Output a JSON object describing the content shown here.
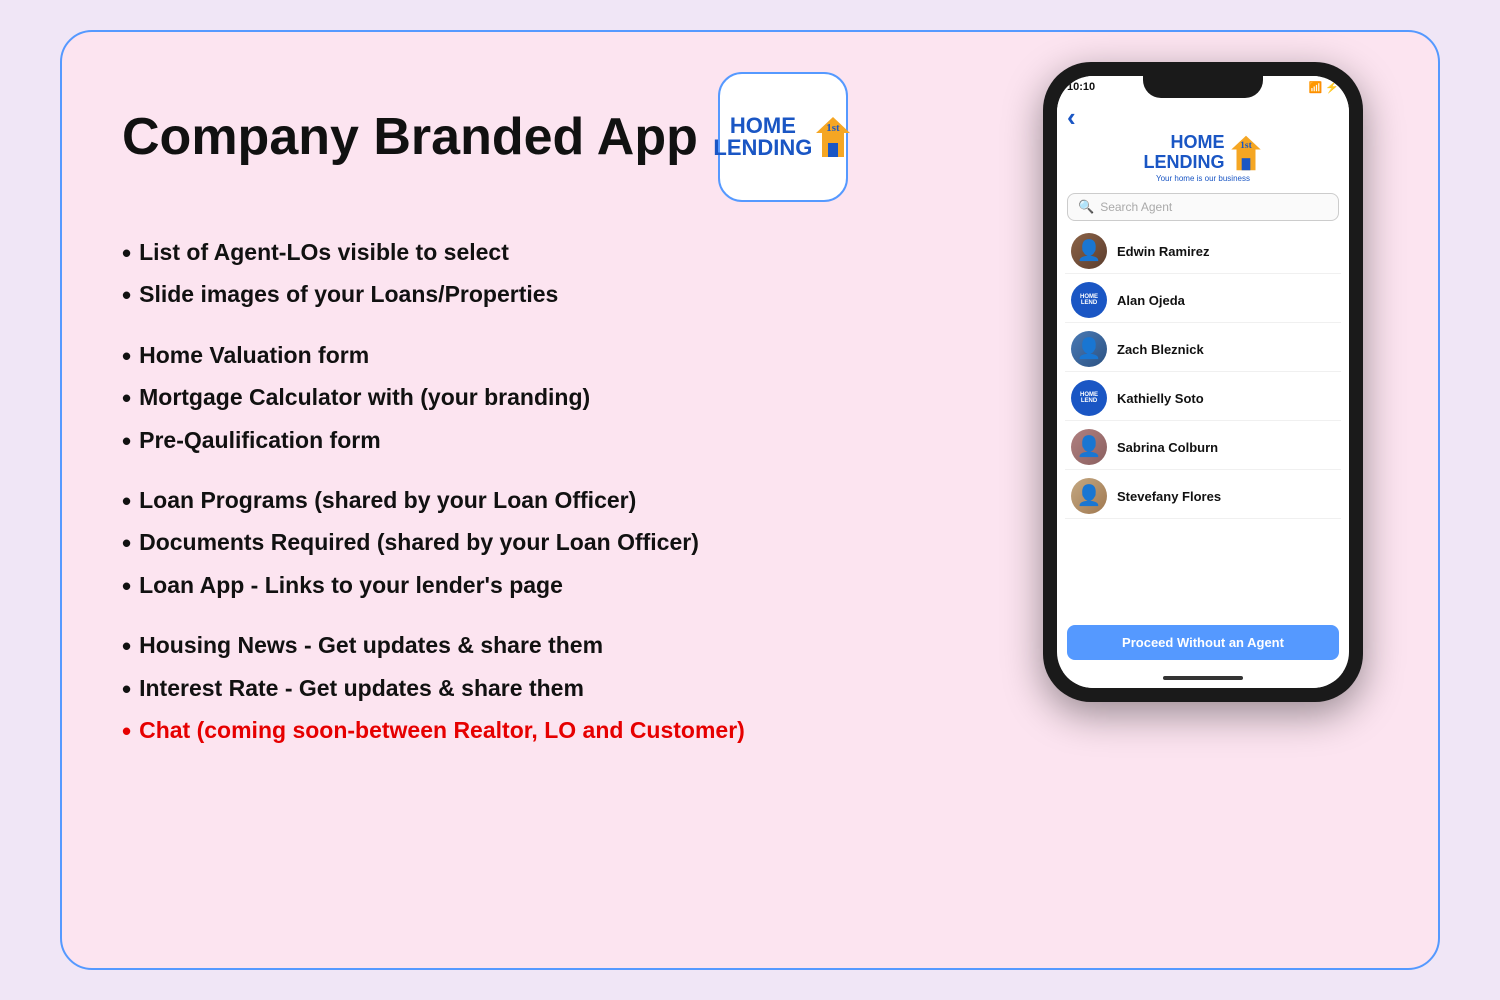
{
  "card": {
    "title": "Company Branded App",
    "logo": {
      "line1": "HOME",
      "line1_super": "1st",
      "line2": "LENDING",
      "tagline": "Your home is our business"
    },
    "bullets": [
      {
        "text": "List of Agent-LOs visible to select",
        "color": "normal"
      },
      {
        "text": "Slide images of your Loans/Properties",
        "color": "normal"
      },
      {
        "text": "Home Valuation form",
        "color": "normal"
      },
      {
        "text": "Mortgage Calculator with (your branding)",
        "color": "normal"
      },
      {
        "text": "Pre-Qaulification form",
        "color": "normal"
      },
      {
        "text": "Loan Programs (shared by your Loan Officer)",
        "color": "normal"
      },
      {
        "text": "Documents Required (shared by your Loan Officer)",
        "color": "normal"
      },
      {
        "text": "Loan App - Links to your lender's page",
        "color": "normal"
      },
      {
        "text": "Housing News - Get updates & share them",
        "color": "normal"
      },
      {
        "text": "Interest Rate - Get updates & share them",
        "color": "normal"
      },
      {
        "text": "Chat (coming soon-between Realtor, LO and Customer)",
        "color": "red"
      }
    ]
  },
  "phone": {
    "status_time": "10:10",
    "search_placeholder": "Search Agent",
    "back_arrow": "‹",
    "agents": [
      {
        "name": "Edwin Ramirez",
        "type": "person",
        "avatar_class": "avatar-person-1"
      },
      {
        "name": "Alan Ojeda",
        "type": "logo",
        "avatar_class": "avatar-logo"
      },
      {
        "name": "Zach Bleznick",
        "type": "person",
        "avatar_class": "avatar-person-3"
      },
      {
        "name": "Kathielly Soto",
        "type": "logo",
        "avatar_class": "avatar-logo"
      },
      {
        "name": "Sabrina Colburn",
        "type": "person",
        "avatar_class": "avatar-person-5"
      },
      {
        "name": "Stevefany Flores",
        "type": "person",
        "avatar_class": "avatar-person-6"
      }
    ],
    "proceed_button": "Proceed Without an Agent"
  }
}
